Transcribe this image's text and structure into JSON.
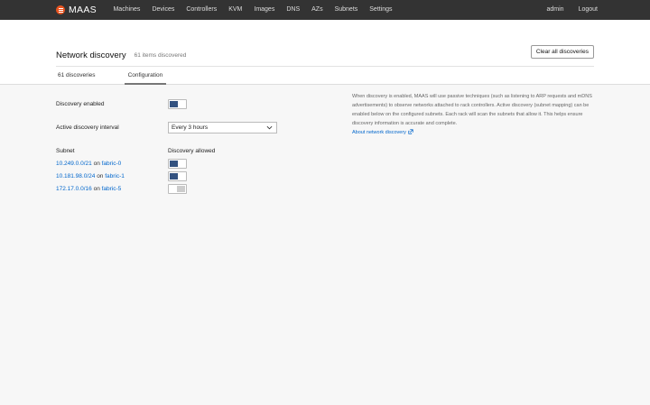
{
  "app": {
    "logo_text": "MAAS",
    "brand_color": "#e95420"
  },
  "nav": {
    "items": [
      "Machines",
      "Devices",
      "Controllers",
      "KVM",
      "Images",
      "DNS",
      "AZs",
      "Subnets",
      "Settings"
    ],
    "right": [
      "admin",
      "Logout"
    ]
  },
  "header": {
    "title": "Network discovery",
    "subtitle": "61 items discovered",
    "clear_button": "Clear all discoveries"
  },
  "tabs": [
    {
      "label": "61 discoveries",
      "active": false
    },
    {
      "label": "Configuration",
      "active": true
    }
  ],
  "config": {
    "discovery_enabled_label": "Discovery enabled",
    "discovery_enabled": true,
    "interval_label": "Active discovery interval",
    "interval_value": "Every 3 hours",
    "subnet_header": "Subnet",
    "allowed_header": "Discovery allowed",
    "subnets": [
      {
        "cidr": "10.249.0.0/21",
        "on": "on",
        "fabric": "fabric-0",
        "allowed": true
      },
      {
        "cidr": "10.181.98.0/24",
        "on": "on",
        "fabric": "fabric-1",
        "allowed": true
      },
      {
        "cidr": "172.17.0.0/16",
        "on": "on",
        "fabric": "fabric-5",
        "allowed": false
      }
    ]
  },
  "info": {
    "text": "When discovery is enabled, MAAS will use passive techniques (such as listening to ARP requests and mDNS advertisements) to observe networks attached to rack controllers. Active discovery (subnet mapping) can be enabled below on the configured subnets. Each rack will scan the subnets that allow it. This helps ensure discovery information is accurate and complete.",
    "link": "About network discovery"
  },
  "colors": {
    "toggle_on": "#335280",
    "link": "#0066cc",
    "nav_bg": "#333333"
  }
}
